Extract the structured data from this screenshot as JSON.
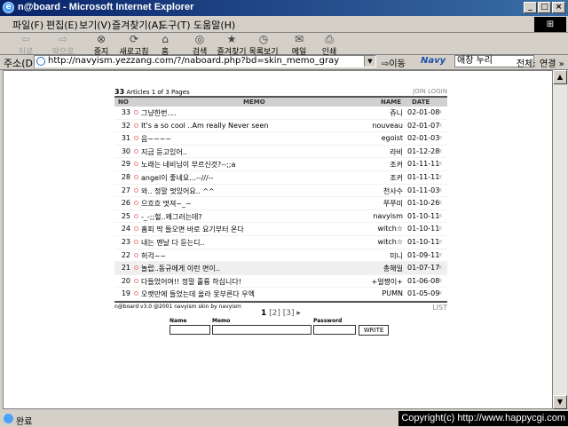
{
  "window": {
    "title": "n@board - Microsoft Internet Explorer",
    "min": "_",
    "max": "□",
    "close": "×"
  },
  "menu": [
    "파일(F)",
    "편집(E)",
    "보기(V)",
    "즐겨찾기(A)",
    "도구(T)",
    "도움말(H)"
  ],
  "toolbar": {
    "back": "뒤로",
    "forward": "앞으로",
    "stop": "중지",
    "refresh": "새로고침",
    "home": "홈",
    "search": "검색",
    "favorites": "즐겨찾기",
    "history": "목록보기",
    "mail": "메일",
    "print": "인쇄"
  },
  "address": {
    "label": "주소(D)",
    "url": "http://navyism.yezzang.com/?/naboard.php?bd=skin_memo_gray",
    "go": "이동"
  },
  "search": {
    "brand": "Navy",
    "value": "애창 누리",
    "scope": "전체:",
    "links": "연결 »"
  },
  "board": {
    "count": "33",
    "count_text": "Articles 1 of 3 Pages",
    "join": "JOIN LOGIN",
    "headers": {
      "no": "NO",
      "memo": "MEMO",
      "name": "NAME",
      "date": "DATE"
    },
    "rows": [
      {
        "no": "33",
        "memo": "그냥한번....",
        "name": "쥬니",
        "date": "02-01-08",
        "x": "x"
      },
      {
        "no": "32",
        "memo": "It's a so cool ..Am really Never seen",
        "name": "nouveau",
        "date": "02-01-07",
        "x": "x"
      },
      {
        "no": "31",
        "memo": "음~~~~",
        "name": "egoist",
        "date": "02-01-03",
        "x": "x"
      },
      {
        "no": "30",
        "memo": "지금 듣고있어..",
        "name": "라비",
        "date": "01-12-28",
        "x": "x"
      },
      {
        "no": "29",
        "memo": "노래는 네비님이 부르신것?--;;a",
        "name": "조커",
        "date": "01-11-11",
        "x": "x"
      },
      {
        "no": "28",
        "memo": "angel이 좋네요...--///--",
        "name": "조커",
        "date": "01-11-11",
        "x": "x"
      },
      {
        "no": "27",
        "memo": "와.. 정말 멋있어요.. ^^",
        "name": "천사수",
        "date": "01-11-03",
        "x": "x"
      },
      {
        "no": "26",
        "memo": "으흐흐 멋져~_~",
        "name": "쭈쭈미",
        "date": "01-10-26",
        "x": "x"
      },
      {
        "no": "25",
        "memo": "-_-;;헐..왜그러는데?",
        "name": "navyism",
        "date": "01-10-11",
        "x": "x"
      },
      {
        "no": "24",
        "memo": "홈피 딱 들오면 바로 요기부터 온다",
        "name": "witch☆",
        "date": "01-10-11",
        "x": "x"
      },
      {
        "no": "23",
        "memo": "내는 멘날 다 듣는디..",
        "name": "witch☆",
        "date": "01-10-11",
        "x": "x"
      },
      {
        "no": "22",
        "memo": "허걱~~",
        "name": "미니",
        "date": "01-09-11",
        "x": "x"
      },
      {
        "no": "21",
        "memo": "놀랍..동규에게 이런 면이..",
        "name": "총해일",
        "date": "01-07-17",
        "x": "x"
      },
      {
        "no": "20",
        "memo": "다들었어여!! 정말 훌륭 하십니다!",
        "name": "+얼쨩이+",
        "date": "01-06-08",
        "x": "x"
      },
      {
        "no": "19",
        "memo": "오랫만에 들었는데 올라 못부른다 우엑",
        "name": "PUMN",
        "date": "01-05-09",
        "x": "x"
      }
    ],
    "credit": "n@board v3.0 @2001 navyism skin by navyism",
    "list": "LIST",
    "pages": {
      "current": "1",
      "p2": "[2]",
      "p3": "[3]",
      "next": "▸"
    },
    "form": {
      "name": "Name",
      "memo": "Memo",
      "password": "Password",
      "write": "WRITE"
    }
  },
  "status": {
    "text": "완료",
    "copyright": "Copyright(c) http://www.happycgi.com"
  }
}
